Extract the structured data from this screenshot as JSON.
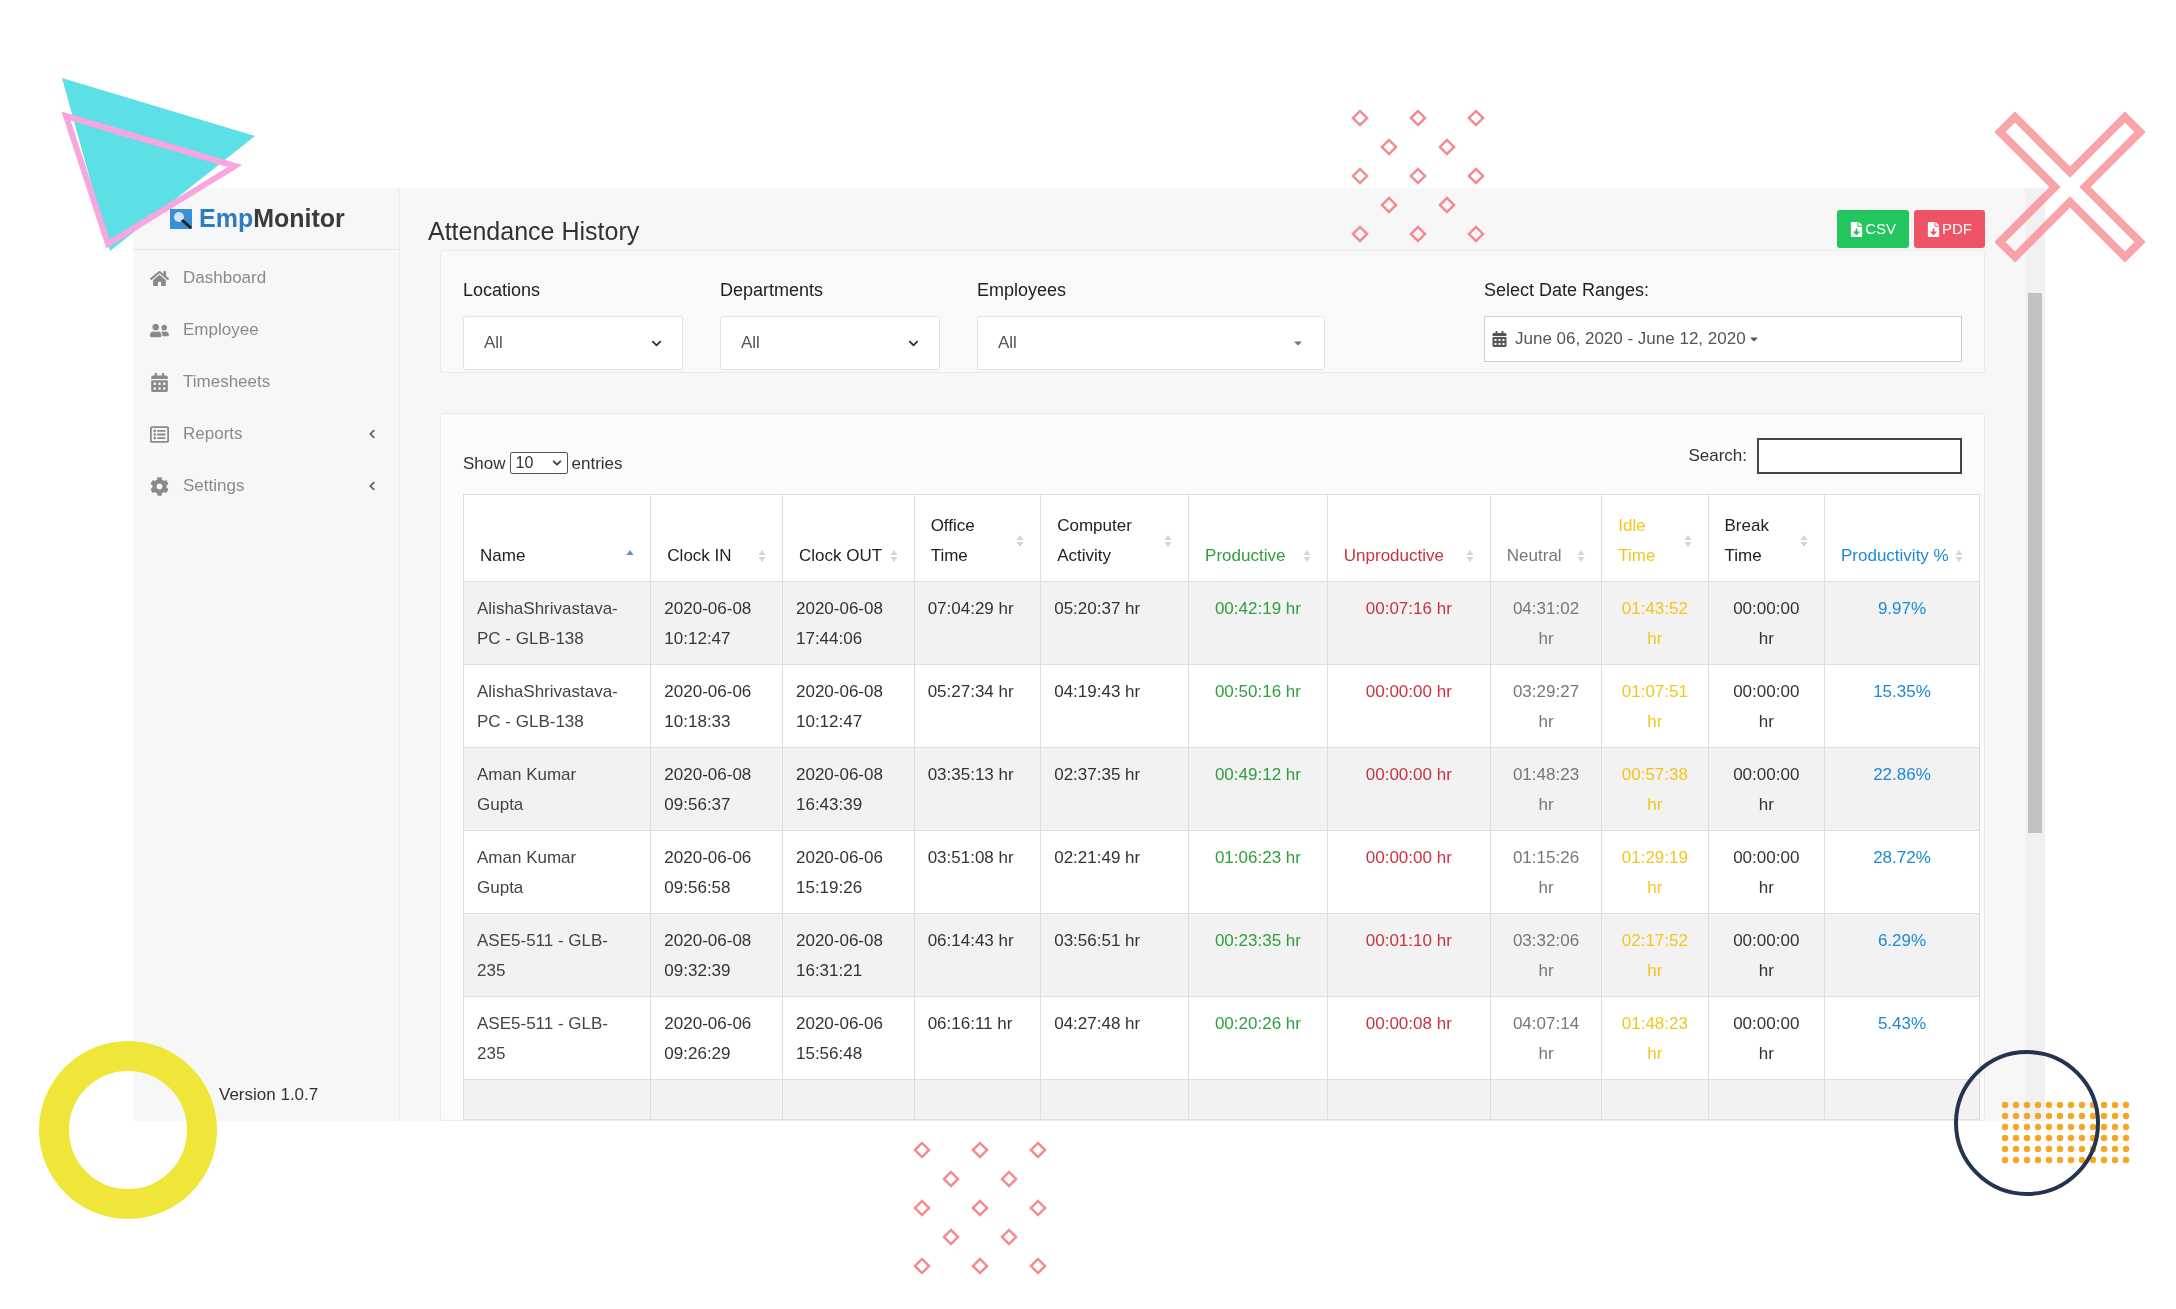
{
  "sidebar": {
    "logo": {
      "brand_part": "Emp",
      "rest": "Monitor"
    },
    "items": [
      {
        "label": "Dashboard",
        "expandable": false
      },
      {
        "label": "Employee",
        "expandable": false
      },
      {
        "label": "Timesheets",
        "expandable": false
      },
      {
        "label": "Reports",
        "expandable": true
      },
      {
        "label": "Settings",
        "expandable": true
      }
    ],
    "version": "Version 1.0.7"
  },
  "page_title": "Attendance History",
  "export_buttons": [
    {
      "label": "CSV",
      "color": "#22c55e"
    },
    {
      "label": "PDF",
      "color": "#ef5366"
    }
  ],
  "filters": [
    {
      "label": "Locations",
      "value": "All",
      "kind": "select"
    },
    {
      "label": "Departments",
      "value": "All",
      "kind": "select"
    },
    {
      "label": "Employees",
      "value": "All",
      "kind": "combo"
    }
  ],
  "date_range": {
    "label": "Select Date Ranges:",
    "value": "June 06, 2020 - June 12, 2020"
  },
  "table": {
    "show_label": "Show",
    "page_size": "10",
    "entries_label": "entries",
    "search_label": "Search:",
    "columns": [
      {
        "label": "Name",
        "color": "#222222",
        "sorted": true
      },
      {
        "label": "Clock IN",
        "color": "#222222",
        "sorted": false
      },
      {
        "label": "Clock OUT",
        "color": "#222222",
        "sorted": false
      },
      {
        "label": "Office Time",
        "color": "#222222",
        "sorted": false
      },
      {
        "label": "Computer Activity",
        "color": "#222222",
        "sorted": false
      },
      {
        "label": "Productive",
        "color": "#2e9e3e",
        "sorted": false
      },
      {
        "label": "Unproductive",
        "color": "#c8333f",
        "sorted": false
      },
      {
        "label": "Neutral",
        "color": "#777777",
        "sorted": false
      },
      {
        "label": "Idle Time",
        "color": "#f2c61f",
        "sorted": false
      },
      {
        "label": "Break Time",
        "color": "#222222",
        "sorted": false
      },
      {
        "label": "Productivity %",
        "color": "#1e88d6",
        "sorted": false
      }
    ],
    "rows": [
      [
        "AlishaShrivastava-PC - GLB-138",
        "2020-06-08 10:12:47",
        "2020-06-08 17:44:06",
        "07:04:29 hr",
        "05:20:37 hr",
        "00:42:19 hr",
        "00:07:16 hr",
        "04:31:02 hr",
        "01:43:52 hr",
        "00:00:00 hr",
        "9.97%"
      ],
      [
        "AlishaShrivastava-PC - GLB-138",
        "2020-06-06 10:18:33",
        "2020-06-08 10:12:47",
        "05:27:34 hr",
        "04:19:43 hr",
        "00:50:16 hr",
        "00:00:00 hr",
        "03:29:27 hr",
        "01:07:51 hr",
        "00:00:00 hr",
        "15.35%"
      ],
      [
        "Aman Kumar Gupta",
        "2020-06-08 09:56:37",
        "2020-06-08 16:43:39",
        "03:35:13 hr",
        "02:37:35 hr",
        "00:49:12 hr",
        "00:00:00 hr",
        "01:48:23 hr",
        "00:57:38 hr",
        "00:00:00 hr",
        "22.86%"
      ],
      [
        "Aman Kumar Gupta",
        "2020-06-06 09:56:58",
        "2020-06-06 15:19:26",
        "03:51:08 hr",
        "02:21:49 hr",
        "01:06:23 hr",
        "00:00:00 hr",
        "01:15:26 hr",
        "01:29:19 hr",
        "00:00:00 hr",
        "28.72%"
      ],
      [
        "ASE5-511 - GLB-235",
        "2020-06-08 09:32:39",
        "2020-06-08 16:31:21",
        "06:14:43 hr",
        "03:56:51 hr",
        "00:23:35 hr",
        "00:01:10 hr",
        "03:32:06 hr",
        "02:17:52 hr",
        "00:00:00 hr",
        "6.29%"
      ],
      [
        "ASE5-511 - GLB-235",
        "2020-06-06 09:26:29",
        "2020-06-06 15:56:48",
        "06:16:11 hr",
        "04:27:48 hr",
        "00:20:26 hr",
        "00:00:08 hr",
        "04:07:14 hr",
        "01:48:23 hr",
        "00:00:00 hr",
        "5.43%"
      ]
    ]
  }
}
